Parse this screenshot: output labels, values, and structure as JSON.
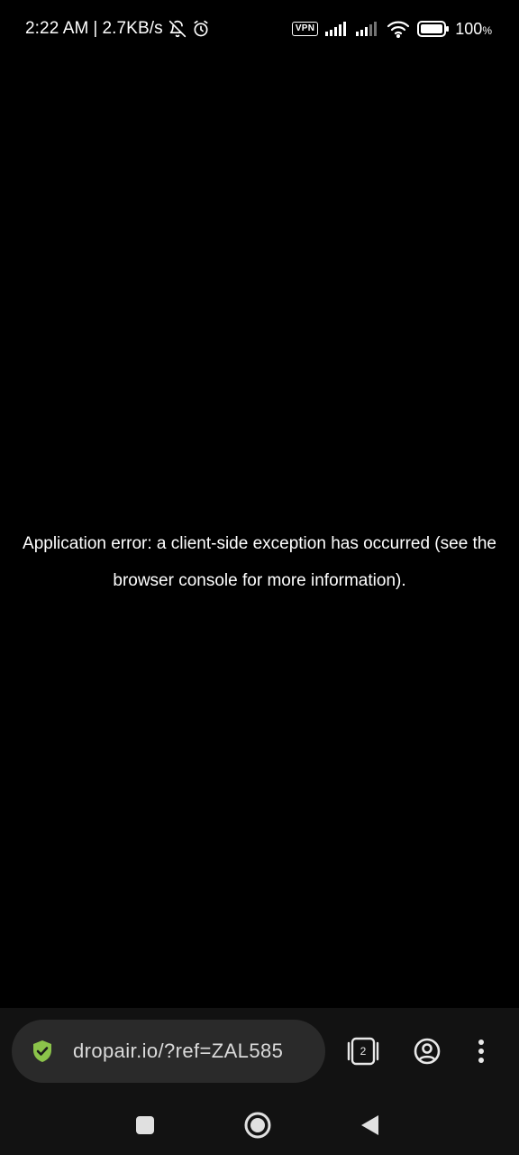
{
  "status_bar": {
    "time": "2:22 AM",
    "separator": "|",
    "net_speed": "2.7KB/s",
    "vpn_label": "VPN",
    "battery_value": "100",
    "battery_unit": "%",
    "icons": [
      "bell-off-icon",
      "alarm-icon",
      "vpn-icon",
      "signal-icon",
      "signal-icon",
      "wifi-icon",
      "battery-icon"
    ]
  },
  "error": {
    "line1": "Application error: a client-side exception has occurred (see the",
    "line2": "browser console for more information)."
  },
  "toolbar": {
    "url": "dropair.io/?ref=ZAL585",
    "tab_count": "2",
    "security_icon": "shield-check-icon",
    "security_color": "#8bc34a"
  },
  "nav_bar": {
    "icons": [
      "recents-icon",
      "home-icon",
      "back-icon"
    ]
  }
}
